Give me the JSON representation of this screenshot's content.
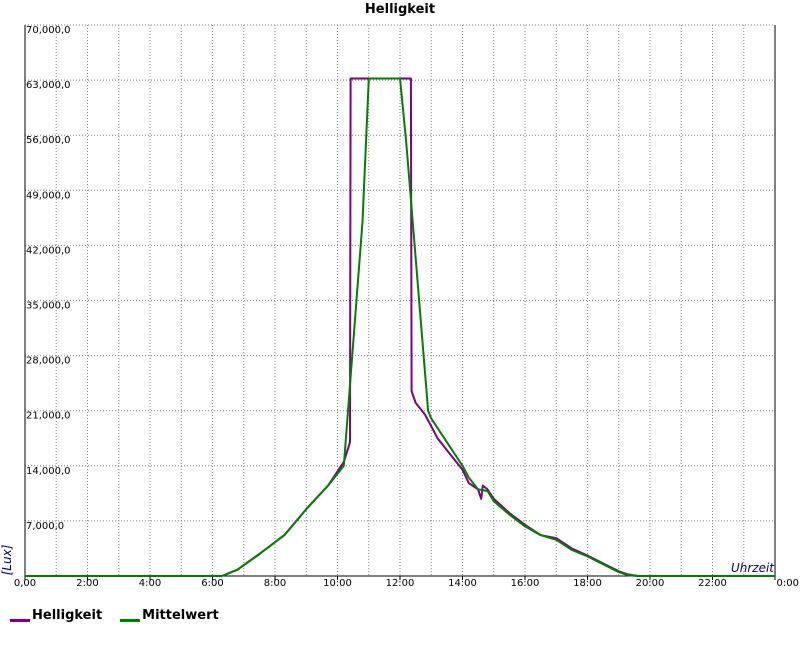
{
  "chart_data": {
    "type": "line",
    "title": "Helligkeit",
    "xlabel": "Uhrzeit",
    "ylabel": "[Lux]",
    "xlim": [
      0,
      24
    ],
    "ylim": [
      0,
      70000
    ],
    "grid": true,
    "legend_position": "bottom-left",
    "y_tick_labels": [
      "0,00",
      "7,000,0",
      "14,000,0",
      "21,000,0",
      "28,000,0",
      "35,000,0",
      "42,000,0",
      "49,000,0",
      "56,000,0",
      "63,000,0",
      "70,000,0"
    ],
    "y_tick_values": [
      0,
      7000,
      14000,
      21000,
      28000,
      35000,
      42000,
      49000,
      56000,
      63000,
      70000
    ],
    "x_tick_labels": [
      "0,00",
      "2:00",
      "4:00",
      "6:00",
      "8:00",
      "10:00",
      "12:00",
      "14:00",
      "16:00",
      "18:00",
      "20:00",
      "22:00",
      "0:00"
    ],
    "x_tick_values": [
      0,
      2,
      4,
      6,
      8,
      10,
      12,
      14,
      16,
      18,
      20,
      22,
      24
    ],
    "series": [
      {
        "name": "Helligkeit",
        "color": "#800080",
        "x": [
          0,
          6.3,
          6.8,
          7.5,
          8.3,
          9.0,
          9.7,
          10.2,
          10.4,
          10.42,
          11.0,
          12.0,
          12.35,
          12.37,
          12.5,
          12.8,
          13.0,
          13.2,
          13.5,
          14.0,
          14.2,
          14.5,
          14.6,
          14.65,
          14.8,
          15.0,
          15.5,
          16.0,
          16.5,
          17.0,
          17.5,
          18.0,
          18.5,
          19.0,
          19.3,
          19.6,
          20.0,
          22.0,
          24.0
        ],
        "y": [
          0,
          0,
          800,
          2800,
          5200,
          8500,
          11500,
          14500,
          17000,
          63200,
          63200,
          63200,
          63200,
          23500,
          22000,
          20500,
          19000,
          17500,
          16000,
          13500,
          11800,
          11000,
          9800,
          11500,
          11000,
          9800,
          8000,
          6500,
          5200,
          4800,
          3500,
          2600,
          1600,
          600,
          200,
          0,
          0,
          0,
          0
        ]
      },
      {
        "name": "Mittelwert",
        "color": "#008000",
        "x": [
          0,
          6.3,
          6.8,
          7.5,
          8.3,
          9.0,
          9.7,
          10.2,
          10.8,
          11.0,
          12.0,
          12.2,
          12.9,
          13.0,
          13.5,
          14.0,
          14.2,
          14.5,
          14.8,
          15.0,
          15.5,
          16.0,
          16.5,
          17.0,
          17.5,
          18.0,
          18.5,
          19.0,
          19.3,
          19.6,
          20.0,
          22.0,
          24.0
        ],
        "y": [
          0,
          0,
          800,
          2800,
          5200,
          8500,
          11500,
          14000,
          45000,
          63200,
          63200,
          55000,
          21000,
          20000,
          17000,
          14000,
          12500,
          11000,
          10800,
          9500,
          7800,
          6300,
          5200,
          4600,
          3300,
          2500,
          1500,
          500,
          100,
          0,
          0,
          0,
          0
        ]
      }
    ]
  }
}
